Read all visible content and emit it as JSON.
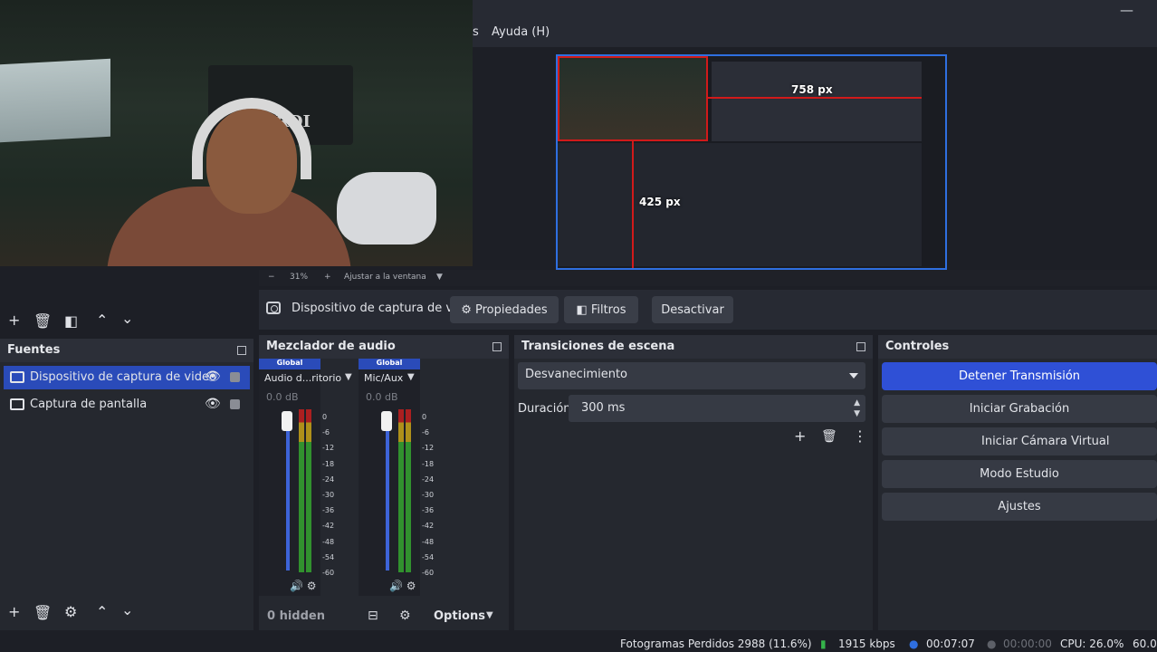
{
  "menubar": {
    "items": [
      {
        "label": "s"
      },
      {
        "label": "Ayuda (H)"
      }
    ]
  },
  "preview": {
    "label_h": "758 px",
    "label_v": "425 px"
  },
  "zoom_row": {
    "minus": "−",
    "zoom": "31%",
    "plus": "+",
    "fit": "Ajustar a la ventana"
  },
  "source_toolbar": {
    "source_name": "Dispositivo de captura de v",
    "properties": "Propiedades",
    "filters": "Filtros",
    "deactivate": "Desactivar"
  },
  "fuentes": {
    "title": "Fuentes",
    "items": [
      {
        "label": "Dispositivo de captura de video"
      },
      {
        "label": "Captura de pantalla"
      }
    ]
  },
  "mixer": {
    "title": "Mezclador de audio",
    "channels": [
      {
        "tag": "Global",
        "name": "Audio d...ritorio",
        "db": "0.0 dB"
      },
      {
        "tag": "Global",
        "name": "Mic/Aux",
        "db": "0.0 dB"
      }
    ],
    "scale": [
      "0",
      "-6",
      "-12",
      "-18",
      "-24",
      "-30",
      "-36",
      "-42",
      "-48",
      "-54",
      "-60"
    ],
    "hidden": "0 hidden",
    "options": "Options"
  },
  "transitions": {
    "title": "Transiciones de escena",
    "selected": "Desvanecimiento",
    "duration_label": "Duración",
    "duration_value": "300 ms"
  },
  "controles": {
    "title": "Controles",
    "buttons": [
      {
        "label": "Detener Transmisión"
      },
      {
        "label": "Iniciar Grabación"
      },
      {
        "label": "Iniciar Cámara Virtual"
      },
      {
        "label": "Modo Estudio"
      },
      {
        "label": "Ajustes"
      }
    ]
  },
  "statusbar": {
    "dropped": "Fotogramas Perdidos 2988 (11.6%)",
    "bitrate": "1915 kbps",
    "stream_time": "00:07:07",
    "rec_time": "00:00:00",
    "cpu": "CPU: 26.0%",
    "fps": "60.0"
  },
  "webcam": {
    "banner_text": "ARDI"
  },
  "colors": {
    "accent": "#2f50d6",
    "selection": "#2a4bb9",
    "dock": "#25282f"
  }
}
